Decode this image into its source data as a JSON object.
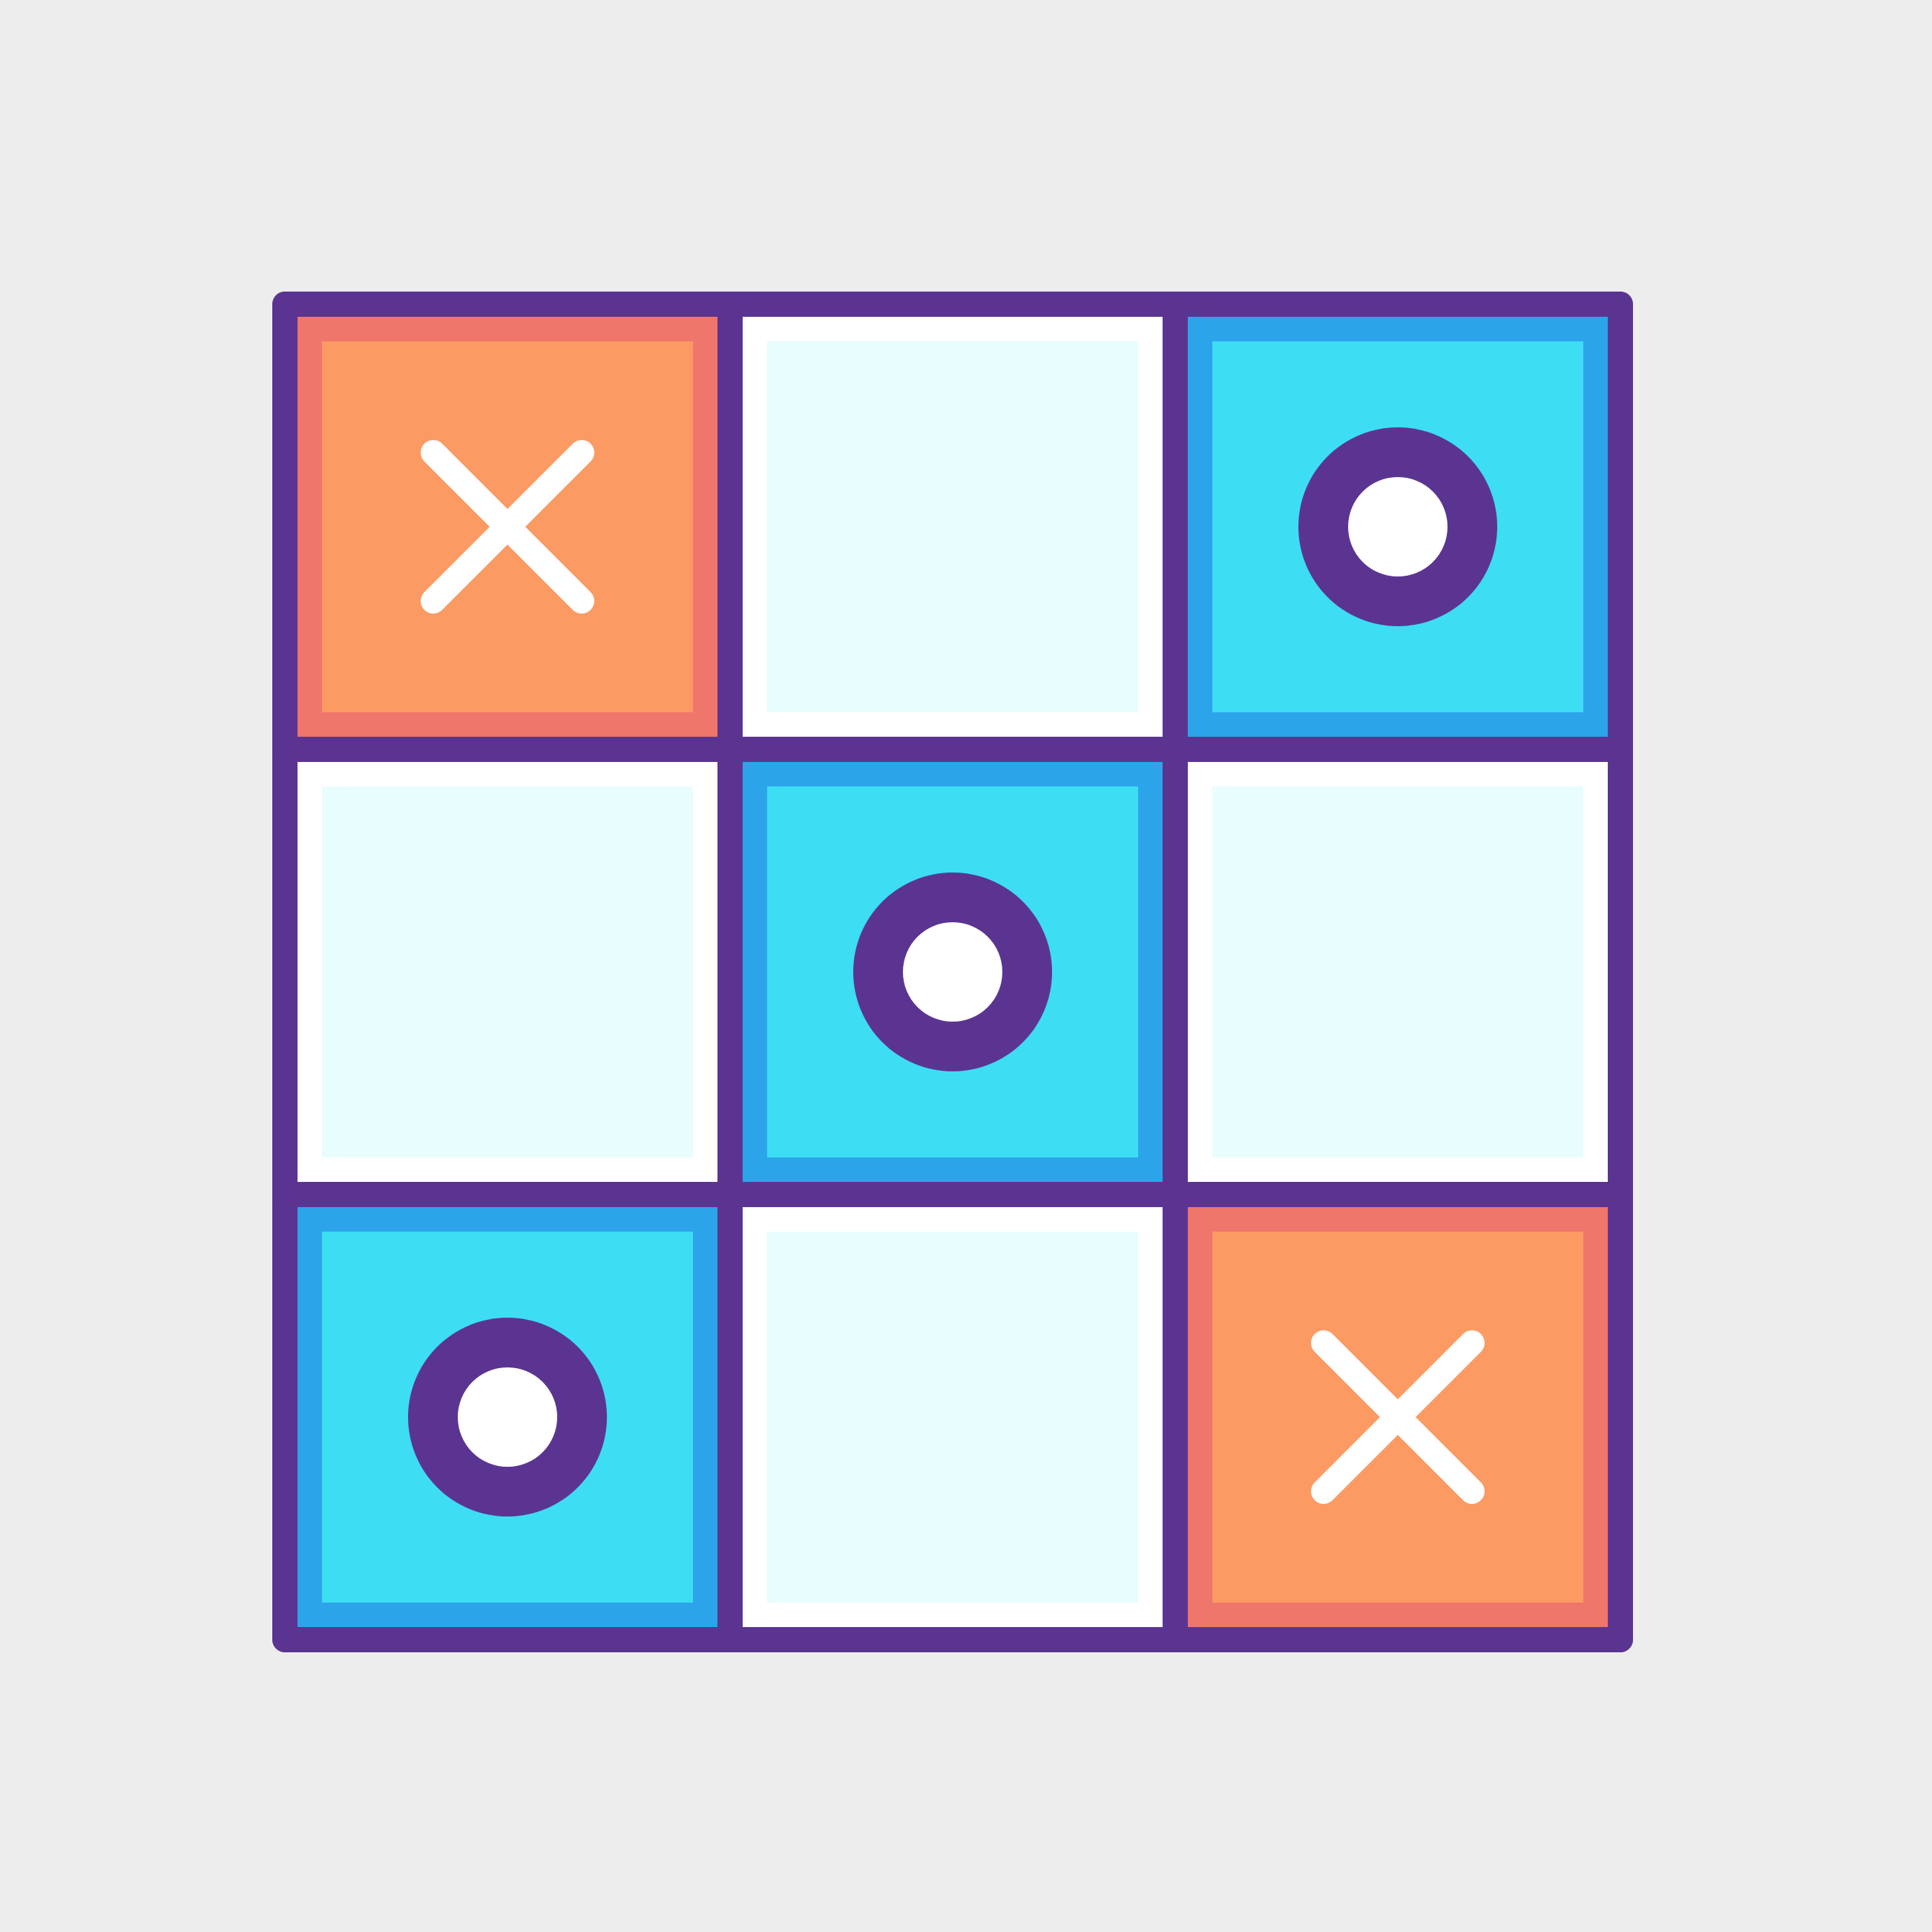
{
  "board": {
    "rows": 3,
    "cols": 3,
    "cells": [
      "X",
      "",
      "O",
      "",
      "O",
      "",
      "O",
      "",
      "X"
    ]
  },
  "colors": {
    "background": "#ededed",
    "grid": "#5b3492",
    "x_border": "#ef766b",
    "x_fill": "#fb9a62",
    "o_border": "#2ca4ea",
    "o_fill": "#3dddf4",
    "empty_border": "#ffffff",
    "empty_fill": "#e8fdfe",
    "mark_x": "#ffffff",
    "mark_o_ring": "#5b3492",
    "mark_o_center": "#ffffff"
  },
  "icons": {
    "x_mark": "x-mark-icon",
    "o_mark": "o-mark-icon"
  }
}
